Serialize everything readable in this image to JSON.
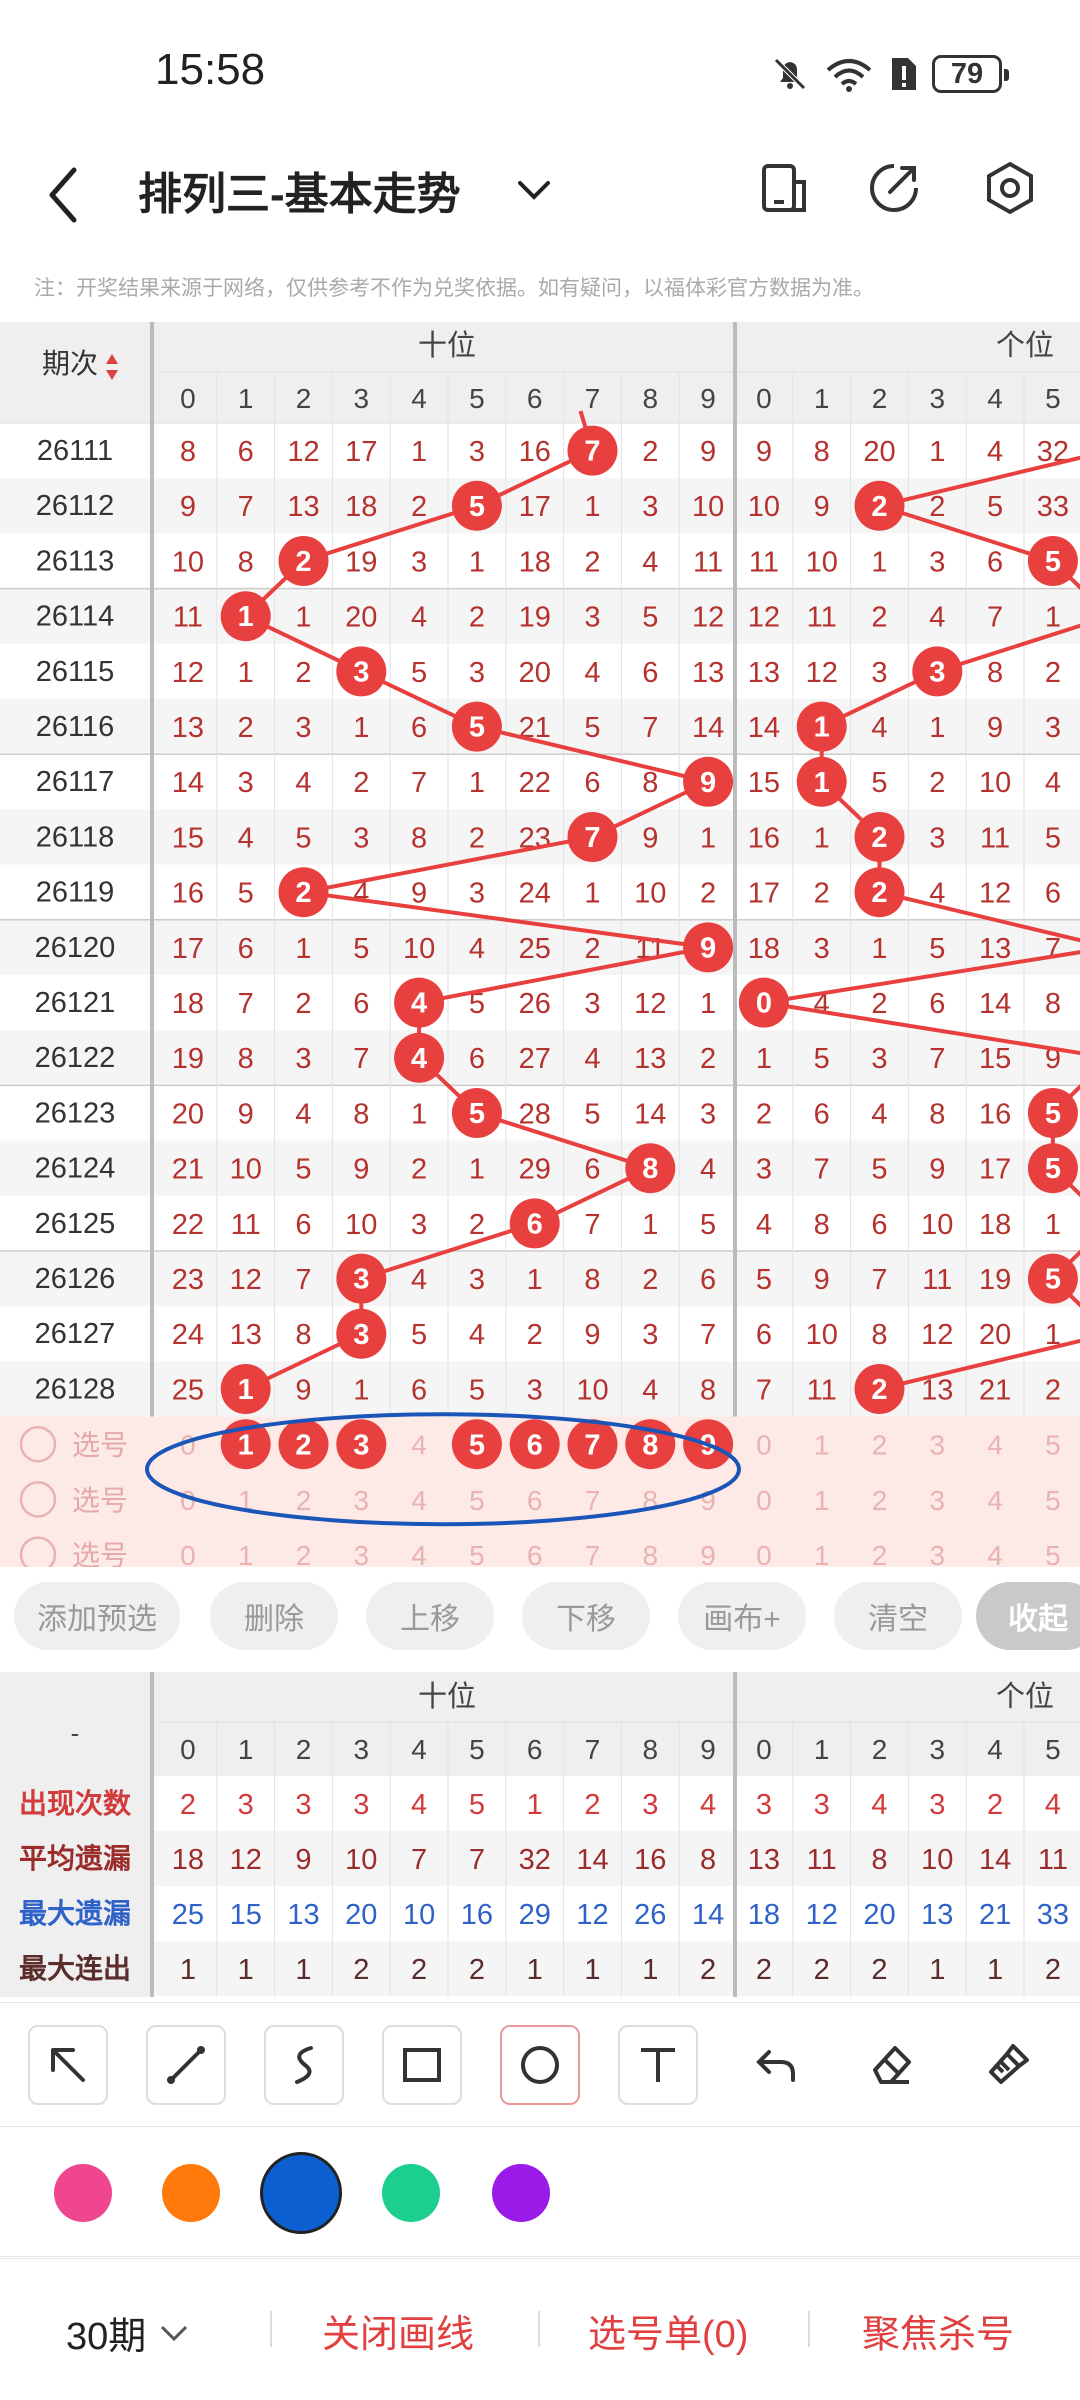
{
  "status": {
    "time": "15:58",
    "battery": "79"
  },
  "header": {
    "title": "排列三-基本走势"
  },
  "note": "注：开奖结果来源于网络，仅供参考不作为兑奖依据。如有疑问，以福体彩官方数据为准。",
  "table": {
    "period_label": "期次",
    "group_tens": "十位",
    "group_units": "个位",
    "digits": [
      "0",
      "1",
      "2",
      "3",
      "4",
      "5",
      "6",
      "7",
      "8",
      "9"
    ],
    "rows": [
      {
        "period": "26111",
        "tens": [
          "8",
          "6",
          "12",
          "17",
          "1",
          "3",
          "16",
          "7",
          "2",
          "9"
        ],
        "units": [
          "9",
          "8",
          "20",
          "1",
          "4",
          "32"
        ]
      },
      {
        "period": "26112",
        "tens": [
          "9",
          "7",
          "13",
          "18",
          "2",
          "5",
          "17",
          "1",
          "3",
          "10"
        ],
        "units": [
          "10",
          "9",
          "2",
          "2",
          "5",
          "33"
        ]
      },
      {
        "period": "26113",
        "tens": [
          "10",
          "8",
          "2",
          "19",
          "3",
          "1",
          "18",
          "2",
          "4",
          "11"
        ],
        "units": [
          "11",
          "10",
          "1",
          "3",
          "6",
          "5"
        ]
      },
      {
        "period": "26114",
        "tens": [
          "11",
          "1",
          "1",
          "20",
          "4",
          "2",
          "19",
          "3",
          "5",
          "12"
        ],
        "units": [
          "12",
          "11",
          "2",
          "4",
          "7",
          "1"
        ]
      },
      {
        "period": "26115",
        "tens": [
          "12",
          "1",
          "2",
          "3",
          "5",
          "3",
          "20",
          "4",
          "6",
          "13"
        ],
        "units": [
          "13",
          "12",
          "3",
          "3",
          "8",
          "2"
        ]
      },
      {
        "period": "26116",
        "tens": [
          "13",
          "2",
          "3",
          "1",
          "6",
          "5",
          "21",
          "5",
          "7",
          "14"
        ],
        "units": [
          "14",
          "1",
          "4",
          "1",
          "9",
          "3"
        ]
      },
      {
        "period": "26117",
        "tens": [
          "14",
          "3",
          "4",
          "2",
          "7",
          "1",
          "22",
          "6",
          "8",
          "9"
        ],
        "units": [
          "15",
          "1",
          "5",
          "2",
          "10",
          "4"
        ]
      },
      {
        "period": "26118",
        "tens": [
          "15",
          "4",
          "5",
          "3",
          "8",
          "2",
          "23",
          "7",
          "9",
          "1"
        ],
        "units": [
          "16",
          "1",
          "2",
          "3",
          "11",
          "5"
        ]
      },
      {
        "period": "26119",
        "tens": [
          "16",
          "5",
          "2",
          "4",
          "9",
          "3",
          "24",
          "1",
          "10",
          "2"
        ],
        "units": [
          "17",
          "2",
          "2",
          "4",
          "12",
          "6"
        ]
      },
      {
        "period": "26120",
        "tens": [
          "17",
          "6",
          "1",
          "5",
          "10",
          "4",
          "25",
          "2",
          "11",
          "9"
        ],
        "units": [
          "18",
          "3",
          "1",
          "5",
          "13",
          "7"
        ]
      },
      {
        "period": "26121",
        "tens": [
          "18",
          "7",
          "2",
          "6",
          "4",
          "5",
          "26",
          "3",
          "12",
          "1"
        ],
        "units": [
          "0",
          "4",
          "2",
          "6",
          "14",
          "8"
        ]
      },
      {
        "period": "26122",
        "tens": [
          "19",
          "8",
          "3",
          "7",
          "4",
          "6",
          "27",
          "4",
          "13",
          "2"
        ],
        "units": [
          "1",
          "5",
          "3",
          "7",
          "15",
          "9"
        ]
      },
      {
        "period": "26123",
        "tens": [
          "20",
          "9",
          "4",
          "8",
          "1",
          "5",
          "28",
          "5",
          "14",
          "3"
        ],
        "units": [
          "2",
          "6",
          "4",
          "8",
          "16",
          "5"
        ]
      },
      {
        "period": "26124",
        "tens": [
          "21",
          "10",
          "5",
          "9",
          "2",
          "1",
          "29",
          "6",
          "8",
          "4"
        ],
        "units": [
          "3",
          "7",
          "5",
          "9",
          "17",
          "5"
        ]
      },
      {
        "period": "26125",
        "tens": [
          "22",
          "11",
          "6",
          "10",
          "3",
          "2",
          "6",
          "7",
          "1",
          "5"
        ],
        "units": [
          "4",
          "8",
          "6",
          "10",
          "18",
          "1"
        ]
      },
      {
        "period": "26126",
        "tens": [
          "23",
          "12",
          "7",
          "3",
          "4",
          "3",
          "1",
          "8",
          "2",
          "6"
        ],
        "units": [
          "5",
          "9",
          "7",
          "11",
          "19",
          "5"
        ]
      },
      {
        "period": "26127",
        "tens": [
          "24",
          "13",
          "8",
          "3",
          "5",
          "4",
          "2",
          "9",
          "3",
          "7"
        ],
        "units": [
          "6",
          "10",
          "8",
          "12",
          "20",
          "1"
        ]
      },
      {
        "period": "26128",
        "tens": [
          "25",
          "1",
          "9",
          "1",
          "6",
          "5",
          "3",
          "10",
          "4",
          "8"
        ],
        "units": [
          "7",
          "11",
          "2",
          "13",
          "21",
          "2"
        ]
      }
    ],
    "hits": [
      {
        "t": 7,
        "u": null
      },
      {
        "t": 5,
        "u": 2
      },
      {
        "t": 2,
        "u": 5
      },
      {
        "t": 1,
        "u": null
      },
      {
        "t": 3,
        "u": 3
      },
      {
        "t": 5,
        "u": 1
      },
      {
        "t": 9,
        "u": 1
      },
      {
        "t": 7,
        "u": 2
      },
      {
        "t": 2,
        "u": 2
      },
      {
        "t": 9,
        "u": null
      },
      {
        "t": 4,
        "u": 0
      },
      {
        "t": 4,
        "u": null
      },
      {
        "t": 5,
        "u": 5
      },
      {
        "t": 8,
        "u": 5
      },
      {
        "t": 6,
        "u": null
      },
      {
        "t": 3,
        "u": 5
      },
      {
        "t": 3,
        "u": null
      },
      {
        "t": 1,
        "u": 2
      }
    ],
    "pick_label": "选号",
    "pick_selected": [
      1,
      2,
      3,
      5,
      6,
      7,
      8,
      9
    ]
  },
  "actions": [
    "添加预选",
    "删除",
    "上移",
    "下移",
    "画布+",
    "清空",
    "收起"
  ],
  "stats": {
    "dash": "-",
    "group_tens": "十位",
    "group_units": "个位",
    "rows": [
      {
        "label": "出现次数",
        "color": "#d23b3b",
        "tens": [
          "2",
          "3",
          "3",
          "3",
          "4",
          "5",
          "1",
          "2",
          "3",
          "4"
        ],
        "units": [
          "3",
          "3",
          "4",
          "3",
          "2",
          "4"
        ]
      },
      {
        "label": "平均遗漏",
        "color": "#9b2c2c",
        "tens": [
          "18",
          "12",
          "9",
          "10",
          "7",
          "7",
          "32",
          "14",
          "16",
          "8"
        ],
        "units": [
          "13",
          "11",
          "8",
          "10",
          "14",
          "11"
        ]
      },
      {
        "label": "最大遗漏",
        "color": "#2f62c8",
        "tens": [
          "25",
          "15",
          "13",
          "20",
          "10",
          "16",
          "29",
          "12",
          "26",
          "14"
        ],
        "units": [
          "18",
          "12",
          "20",
          "13",
          "21",
          "33"
        ]
      },
      {
        "label": "最大连出",
        "color": "#5a2c2c",
        "tens": [
          "1",
          "1",
          "1",
          "2",
          "2",
          "2",
          "1",
          "1",
          "1",
          "2"
        ],
        "units": [
          "2",
          "2",
          "2",
          "1",
          "1",
          "2"
        ]
      }
    ]
  },
  "tools": [
    "arrow-tool-icon",
    "line-tool-icon",
    "curve-tool-icon",
    "rect-tool-icon",
    "circle-tool-icon",
    "text-tool-icon",
    "undo-icon",
    "eraser-icon",
    "clear-brush-icon"
  ],
  "colors": [
    "#f0468f",
    "#ff7a0a",
    "#0b5fd0",
    "#1dcf8f",
    "#9a1be8"
  ],
  "bottom": {
    "period": "30期",
    "close": "关闭画线",
    "picks": "选号单(0)",
    "focus": "聚焦杀号"
  }
}
